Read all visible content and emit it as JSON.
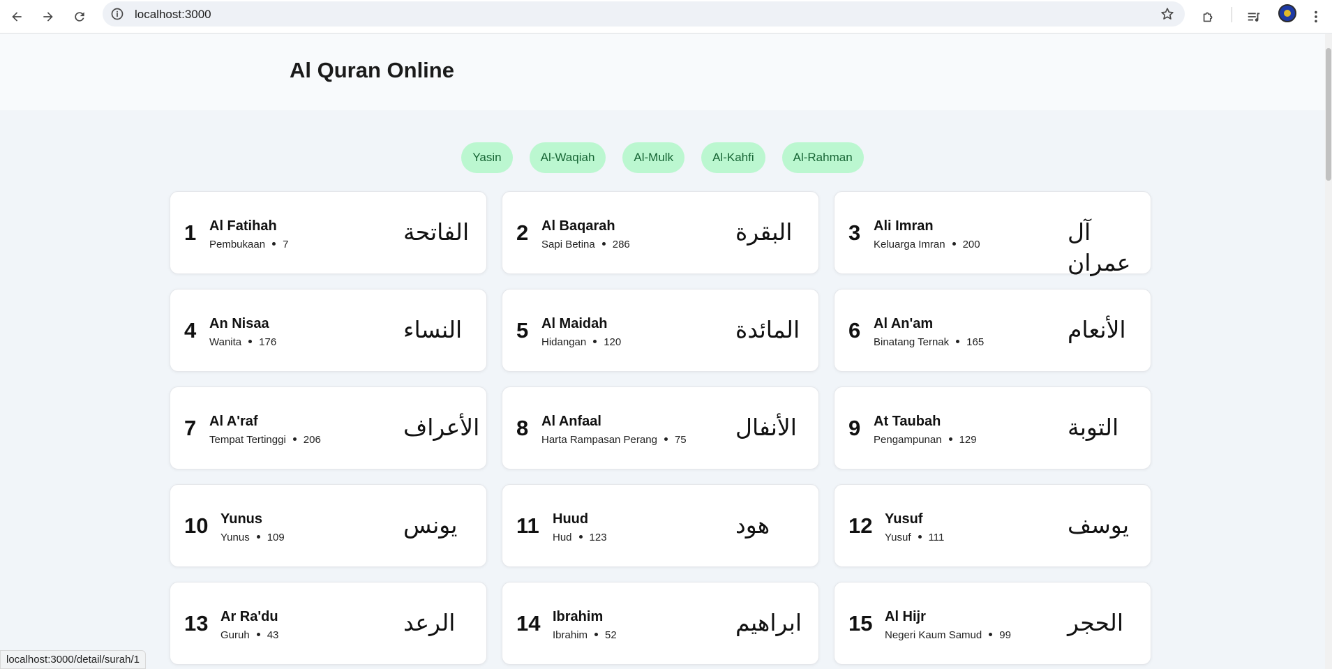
{
  "browser": {
    "url": "localhost:3000",
    "status_url": "localhost:3000/detail/surah/1"
  },
  "page": {
    "title": "Al Quran Online"
  },
  "quick_links": [
    "Yasin",
    "Al-Waqiah",
    "Al-Mulk",
    "Al-Kahfi",
    "Al-Rahman"
  ],
  "surahs": [
    {
      "number": "1",
      "name": "Al Fatihah",
      "meaning": "Pembukaan",
      "ayat": "7",
      "arabic": "الفاتحة"
    },
    {
      "number": "2",
      "name": "Al Baqarah",
      "meaning": "Sapi Betina",
      "ayat": "286",
      "arabic": "البقرة"
    },
    {
      "number": "3",
      "name": "Ali Imran",
      "meaning": "Keluarga Imran",
      "ayat": "200",
      "arabic": "آل عمران"
    },
    {
      "number": "4",
      "name": "An Nisaa",
      "meaning": "Wanita",
      "ayat": "176",
      "arabic": "النساء"
    },
    {
      "number": "5",
      "name": "Al Maidah",
      "meaning": "Hidangan",
      "ayat": "120",
      "arabic": "المائدة"
    },
    {
      "number": "6",
      "name": "Al An'am",
      "meaning": "Binatang Ternak",
      "ayat": "165",
      "arabic": "الأنعام"
    },
    {
      "number": "7",
      "name": "Al A'raf",
      "meaning": "Tempat Tertinggi",
      "ayat": "206",
      "arabic": "الأعراف"
    },
    {
      "number": "8",
      "name": "Al Anfaal",
      "meaning": "Harta Rampasan Perang",
      "ayat": "75",
      "arabic": "الأنفال"
    },
    {
      "number": "9",
      "name": "At Taubah",
      "meaning": "Pengampunan",
      "ayat": "129",
      "arabic": "التوبة"
    },
    {
      "number": "10",
      "name": "Yunus",
      "meaning": "Yunus",
      "ayat": "109",
      "arabic": "يونس"
    },
    {
      "number": "11",
      "name": "Huud",
      "meaning": "Hud",
      "ayat": "123",
      "arabic": "هود"
    },
    {
      "number": "12",
      "name": "Yusuf",
      "meaning": "Yusuf",
      "ayat": "111",
      "arabic": "يوسف"
    },
    {
      "number": "13",
      "name": "Ar Ra'du",
      "meaning": "Guruh",
      "ayat": "43",
      "arabic": "الرعد"
    },
    {
      "number": "14",
      "name": "Ibrahim",
      "meaning": "Ibrahim",
      "ayat": "52",
      "arabic": "ابراهيم"
    },
    {
      "number": "15",
      "name": "Al Hijr",
      "meaning": "Negeri Kaum Samud",
      "ayat": "99",
      "arabic": "الحجر"
    }
  ]
}
